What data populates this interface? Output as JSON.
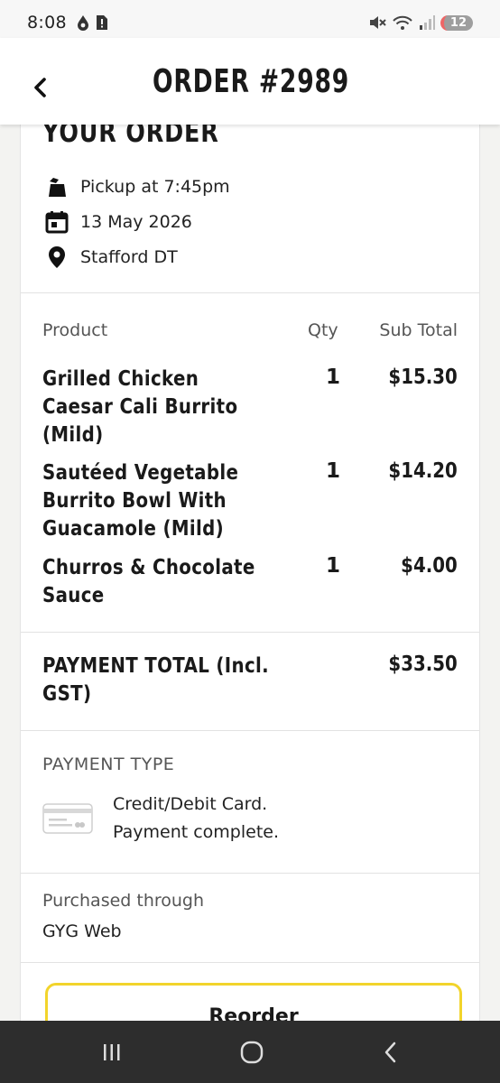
{
  "status_bar": {
    "time": "8:08",
    "notification_count": "12"
  },
  "header": {
    "title": "ORDER #2989"
  },
  "order_info": {
    "heading": "YOUR ORDER",
    "pickup": "Pickup at 7:45pm",
    "date": "13 May 2026",
    "location": "Stafford DT"
  },
  "table": {
    "headers": {
      "product": "Product",
      "qty": "Qty",
      "subtotal": "Sub Total"
    },
    "items": [
      {
        "name": "Grilled Chicken Caesar Cali Burrito (Mild)",
        "qty": "1",
        "price": "$15.30"
      },
      {
        "name": "Sautéed Vegetable Burrito Bowl With Guacamole (Mild)",
        "qty": "1",
        "price": "$14.20"
      },
      {
        "name": "Churros & Chocolate Sauce",
        "qty": "1",
        "price": "$4.00"
      }
    ]
  },
  "payment_total": {
    "label": "PAYMENT TOTAL (Incl. GST)",
    "value": "$33.50"
  },
  "payment_type": {
    "label": "PAYMENT TYPE",
    "method": "Credit/Debit Card.",
    "status": "Payment complete."
  },
  "purchased": {
    "label": "Purchased through",
    "value": "GYG Web"
  },
  "actions": {
    "reorder_label": "Reorder"
  },
  "colors": {
    "accent": "#f2d42b",
    "nav_bar": "#2d2d2d"
  }
}
